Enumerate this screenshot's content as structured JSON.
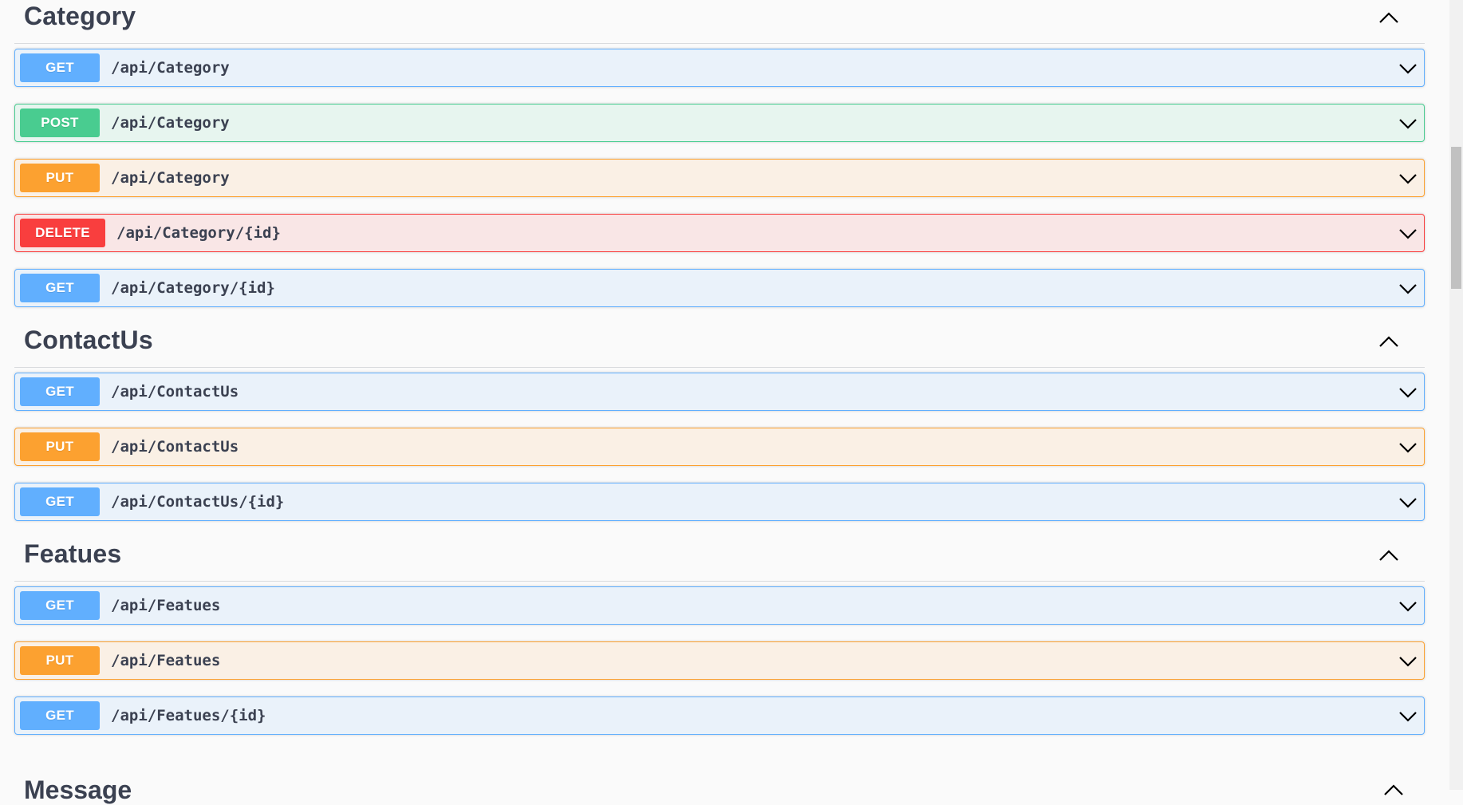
{
  "sections": [
    {
      "title": "Category",
      "operations": [
        {
          "method": "GET",
          "path": "/api/Category"
        },
        {
          "method": "POST",
          "path": "/api/Category"
        },
        {
          "method": "PUT",
          "path": "/api/Category"
        },
        {
          "method": "DELETE",
          "path": "/api/Category/{id}"
        },
        {
          "method": "GET",
          "path": "/api/Category/{id}"
        }
      ]
    },
    {
      "title": "ContactUs",
      "operations": [
        {
          "method": "GET",
          "path": "/api/ContactUs"
        },
        {
          "method": "PUT",
          "path": "/api/ContactUs"
        },
        {
          "method": "GET",
          "path": "/api/ContactUs/{id}"
        }
      ]
    },
    {
      "title": "Featues",
      "operations": [
        {
          "method": "GET",
          "path": "/api/Featues"
        },
        {
          "method": "PUT",
          "path": "/api/Featues"
        },
        {
          "method": "GET",
          "path": "/api/Featues/{id}"
        }
      ]
    }
  ],
  "next_section_title": "Message",
  "colors": {
    "get": "#61affe",
    "post": "#49cc90",
    "put": "#fca130",
    "delete": "#f93e3e"
  },
  "icons": {
    "section_toggle": "chevron-up-icon",
    "operation_toggle": "chevron-down-icon"
  }
}
